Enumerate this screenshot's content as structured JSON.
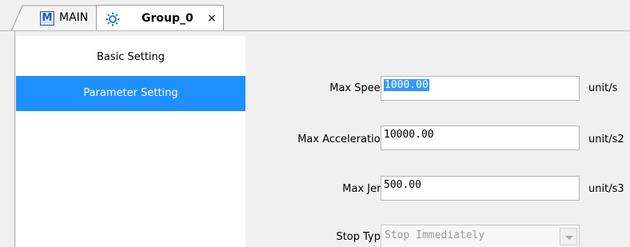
{
  "tabs": {
    "main_label": "MAIN",
    "active_label": "Group_0",
    "close_glyph": "×"
  },
  "sidebar": {
    "items": [
      {
        "label": "Basic Setting",
        "selected": false
      },
      {
        "label": "Parameter Setting",
        "selected": true
      }
    ]
  },
  "form": {
    "max_speed": {
      "label": "Max Speed",
      "value": "1000.00",
      "unit": "unit/s"
    },
    "max_acceleration": {
      "label": "Max Acceleration",
      "value": "10000.00",
      "unit": "unit/s2"
    },
    "max_jerk": {
      "label": "Max Jerk",
      "value": "500.00",
      "unit": "unit/s3"
    },
    "stop_type": {
      "label": "Stop Type",
      "value": "Stop Immediately"
    }
  },
  "colors": {
    "selected_nav": "#1e90ff",
    "icon_blue": "#2d55b7",
    "text_selection": "#3399ff"
  },
  "icons": {
    "main_tab": "m-icon",
    "group_tab": "gear-icon",
    "close": "close-icon",
    "dropdown": "chevron-down-icon"
  }
}
